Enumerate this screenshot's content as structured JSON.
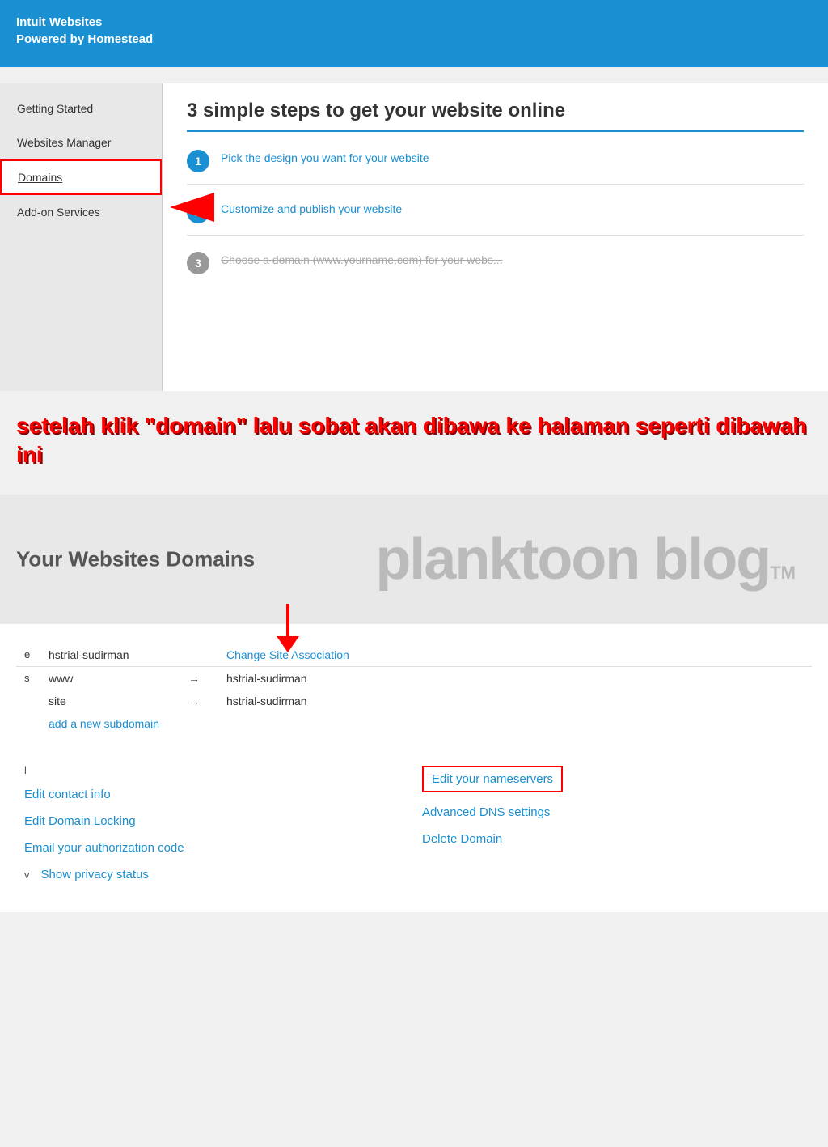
{
  "header": {
    "line1": "Intuit Websites",
    "line2": "Powered by Homestead"
  },
  "sidebar": {
    "items": [
      {
        "label": "Getting Started",
        "active": false
      },
      {
        "label": "Websites Manager",
        "active": false
      },
      {
        "label": "Domains",
        "active": true
      },
      {
        "label": "Add-on Services",
        "active": false
      }
    ]
  },
  "content": {
    "title": "3 simple steps to get your website online",
    "steps": [
      {
        "number": "1",
        "text": "Pick the design you want for your website",
        "active": true,
        "disabled": false
      },
      {
        "number": "2",
        "text": "Customize and publish your website",
        "active": true,
        "disabled": false
      },
      {
        "number": "3",
        "text": "Choose a domain (www.yourname.com) for your webs...",
        "active": false,
        "disabled": true
      }
    ]
  },
  "annotation": {
    "text": "setelah klik \"domain\" lalu sobat akan dibawa ke halaman seperti dibawah ini"
  },
  "watermark": {
    "text": "planktoon blog",
    "tm": "TM"
  },
  "page_title": "Your Websites Domains",
  "domain_table": {
    "main_domain": "hstrial-sudirman",
    "change_site_link": "Change Site Association",
    "subdomains": [
      {
        "label": "s",
        "name": "www",
        "target": "hstrial-sudirman"
      },
      {
        "label": "",
        "name": "site",
        "target": "hstrial-sudirman"
      }
    ],
    "add_subdomain": "add a new subdomain"
  },
  "bottom_links": {
    "left": [
      {
        "label": "Edit contact info"
      },
      {
        "label": "Edit Domain Locking"
      },
      {
        "label": "Email your authorization code"
      },
      {
        "label": "Show privacy status"
      }
    ],
    "right": [
      {
        "label": "Edit your nameservers",
        "highlighted": true
      },
      {
        "label": "Advanced DNS settings"
      },
      {
        "label": "Delete Domain"
      }
    ]
  }
}
